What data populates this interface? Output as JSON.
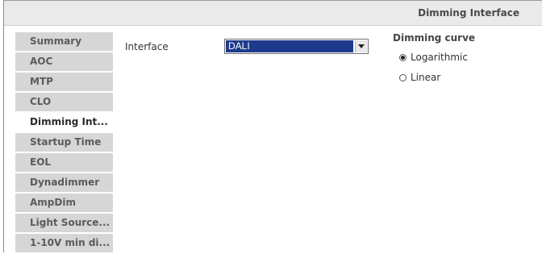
{
  "header": {
    "title": "Dimming Interface"
  },
  "sidebar": {
    "items": [
      {
        "label": "Summary"
      },
      {
        "label": "AOC"
      },
      {
        "label": "MTP"
      },
      {
        "label": "CLO"
      },
      {
        "label": "Dimming Int..."
      },
      {
        "label": "Startup Time"
      },
      {
        "label": "EOL"
      },
      {
        "label": "Dynadimmer"
      },
      {
        "label": "AmpDim"
      },
      {
        "label": "Light Source..."
      },
      {
        "label": "1-10V min di..."
      }
    ],
    "active_index": 4
  },
  "interface": {
    "label": "Interface",
    "value": "DALI"
  },
  "dimming_curve": {
    "title": "Dimming curve",
    "options": [
      {
        "label": "Logarithmic",
        "selected": true
      },
      {
        "label": "Linear",
        "selected": false
      }
    ]
  },
  "colors": {
    "select_highlight": "#1e3a8c",
    "sidebar_bg": "#d6d6d6",
    "header_bg": "#eaeaea"
  }
}
